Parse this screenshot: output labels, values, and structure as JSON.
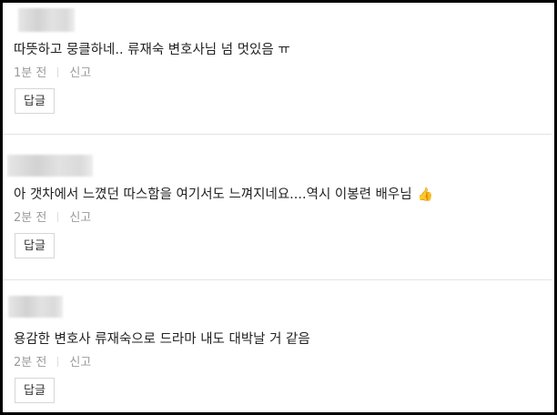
{
  "comments": [
    {
      "text": "따뜻하고 뭉클하네.. 류재숙 변호사님 넘 멋있음 ㅠ",
      "time": "1분 전",
      "report_label": "신고",
      "reply_label": "답글"
    },
    {
      "text": "아 갯차에서 느꼈던 따스함을 여기서도 느껴지네요....역시 이봉련 배우님",
      "emoji": "👍",
      "time": "2분 전",
      "report_label": "신고",
      "reply_label": "답글"
    },
    {
      "text": "용감한 변호사 류재숙으로 드라마 내도 대박날 거 같음",
      "time": "2분 전",
      "report_label": "신고",
      "reply_label": "답글"
    }
  ]
}
